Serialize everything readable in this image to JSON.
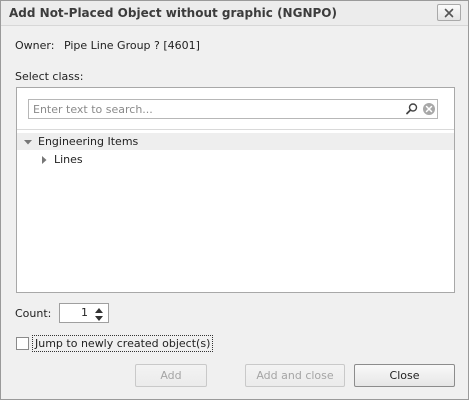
{
  "window": {
    "title": "Add Not-Placed Object without graphic (NGNPO)",
    "close_icon": "close-icon"
  },
  "owner": {
    "label": "Owner:",
    "value": "Pipe Line Group ? [4601]"
  },
  "select_class": {
    "label": "Select class:",
    "search": {
      "placeholder": "Enter text to search...",
      "value": "",
      "search_icon": "magnifier-icon",
      "clear_icon": "clear-circle-x-icon"
    },
    "tree": [
      {
        "label": "Engineering Items",
        "expanded": true,
        "selected": true,
        "level": 0
      },
      {
        "label": "Lines",
        "expanded": false,
        "selected": false,
        "level": 1
      }
    ]
  },
  "count": {
    "label": "Count:",
    "value": "1"
  },
  "jump": {
    "label": "Jump to newly created object(s)",
    "checked": false
  },
  "buttons": {
    "add": "Add",
    "add_and_close": "Add and close",
    "close": "Close"
  },
  "colors": {
    "dialog_bg": "#f0f0f0",
    "panel_bg": "#ffffff",
    "selected_row": "#eeeeee",
    "disabled_text": "#a5a5a5"
  }
}
